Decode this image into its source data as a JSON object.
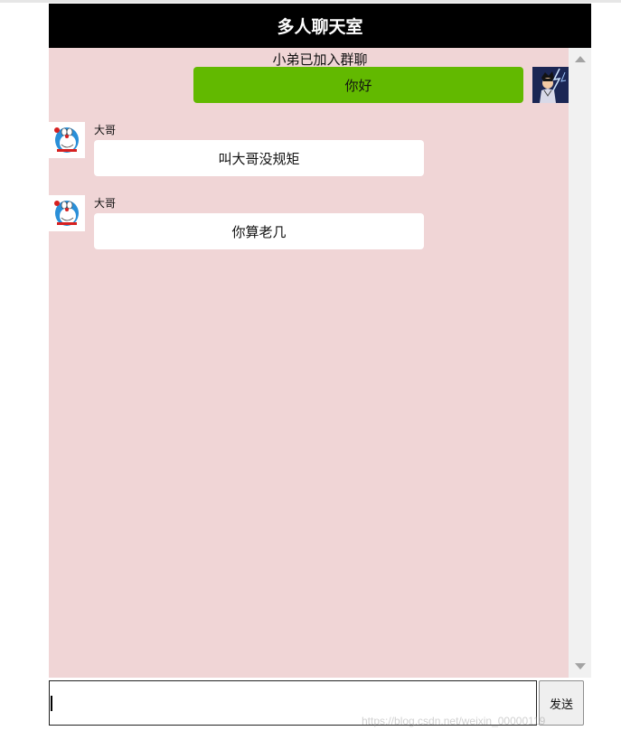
{
  "header": {
    "title": "多人聊天室"
  },
  "chat": {
    "system_message": "小弟已加入群聊",
    "self_message": {
      "text": "你好"
    },
    "messages": [
      {
        "sender": "大哥",
        "text": "叫大哥没规矩"
      },
      {
        "sender": "大哥",
        "text": "你算老几"
      }
    ]
  },
  "composer": {
    "value": "",
    "send_label": "发送"
  },
  "watermark": "https://blog.csdn.net/weixin_00000119",
  "colors": {
    "header_bg": "#000000",
    "chat_bg": "#f0d5d6",
    "self_bubble": "#62b900",
    "other_bubble": "#ffffff"
  },
  "icons": {
    "self_avatar": "anime-character-avatar-icon",
    "other_avatar": "doraemon-avatar-icon"
  }
}
